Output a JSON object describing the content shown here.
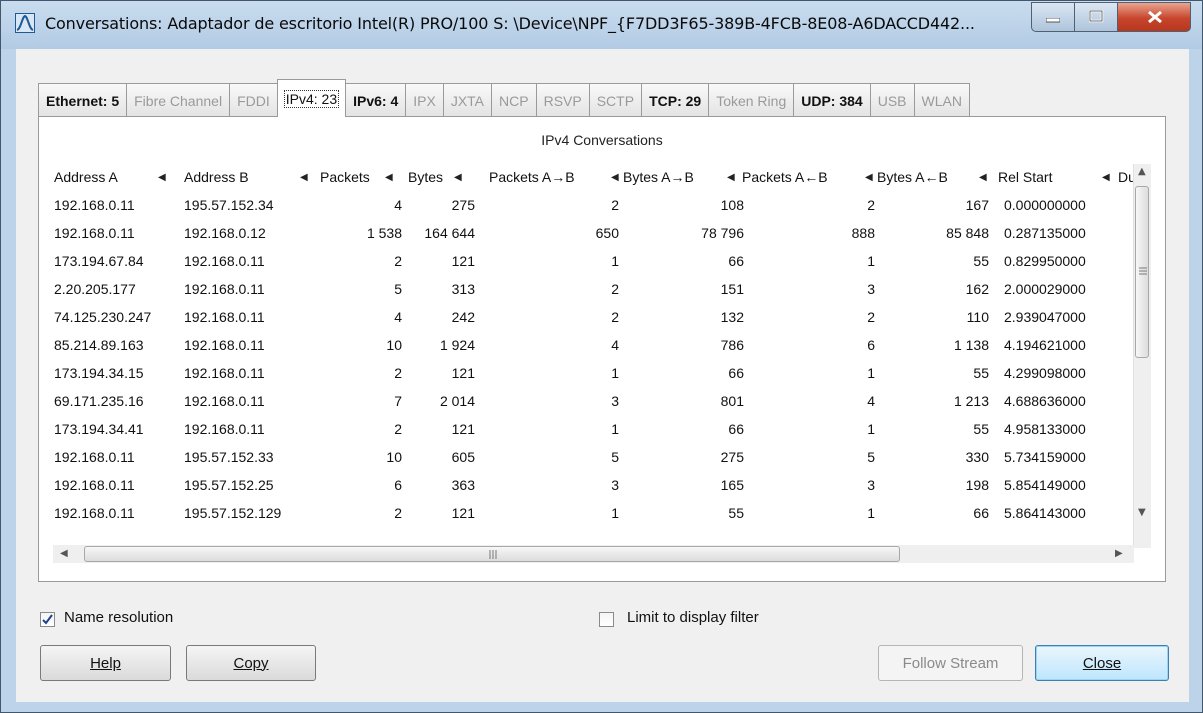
{
  "window": {
    "title": "Conversations: Adaptador de escritorio Intel(R) PRO/100 S: \\Device\\NPF_{F7DD3F65-389B-4FCB-8E08-A6DACCD442..."
  },
  "tabs": [
    {
      "label": "Ethernet: 5",
      "enabled": true
    },
    {
      "label": "Fibre Channel",
      "enabled": false
    },
    {
      "label": "FDDI",
      "enabled": false
    },
    {
      "label": "IPv4: 23",
      "enabled": true,
      "active": true
    },
    {
      "label": "IPv6: 4",
      "enabled": true
    },
    {
      "label": "IPX",
      "enabled": false
    },
    {
      "label": "JXTA",
      "enabled": false
    },
    {
      "label": "NCP",
      "enabled": false
    },
    {
      "label": "RSVP",
      "enabled": false
    },
    {
      "label": "SCTP",
      "enabled": false
    },
    {
      "label": "TCP: 29",
      "enabled": true
    },
    {
      "label": "Token Ring",
      "enabled": false
    },
    {
      "label": "UDP: 384",
      "enabled": true
    },
    {
      "label": "USB",
      "enabled": false
    },
    {
      "label": "WLAN",
      "enabled": false
    }
  ],
  "table": {
    "title": "IPv4 Conversations",
    "columns": [
      "Address A",
      "Address B",
      "Packets",
      "Bytes",
      "Packets A→B",
      "Bytes A→B",
      "Packets A←B",
      "Bytes A←B",
      "Rel Start",
      "Dur"
    ],
    "rows": [
      [
        "192.168.0.11",
        "195.57.152.34",
        "4",
        "275",
        "2",
        "108",
        "2",
        "167",
        "0.000000000"
      ],
      [
        "192.168.0.11",
        "192.168.0.12",
        "1 538",
        "164 644",
        "650",
        "78 796",
        "888",
        "85 848",
        "0.287135000"
      ],
      [
        "173.194.67.84",
        "192.168.0.11",
        "2",
        "121",
        "1",
        "66",
        "1",
        "55",
        "0.829950000"
      ],
      [
        "2.20.205.177",
        "192.168.0.11",
        "5",
        "313",
        "2",
        "151",
        "3",
        "162",
        "2.000029000"
      ],
      [
        "74.125.230.247",
        "192.168.0.11",
        "4",
        "242",
        "2",
        "132",
        "2",
        "110",
        "2.939047000"
      ],
      [
        "85.214.89.163",
        "192.168.0.11",
        "10",
        "1 924",
        "4",
        "786",
        "6",
        "1 138",
        "4.194621000"
      ],
      [
        "173.194.34.15",
        "192.168.0.11",
        "2",
        "121",
        "1",
        "66",
        "1",
        "55",
        "4.299098000"
      ],
      [
        "69.171.235.16",
        "192.168.0.11",
        "7",
        "2 014",
        "3",
        "801",
        "4",
        "1 213",
        "4.688636000"
      ],
      [
        "173.194.34.41",
        "192.168.0.11",
        "2",
        "121",
        "1",
        "66",
        "1",
        "55",
        "4.958133000"
      ],
      [
        "192.168.0.11",
        "195.57.152.33",
        "10",
        "605",
        "5",
        "275",
        "5",
        "330",
        "5.734159000"
      ],
      [
        "192.168.0.11",
        "195.57.152.25",
        "6",
        "363",
        "3",
        "165",
        "3",
        "198",
        "5.854149000"
      ],
      [
        "192.168.0.11",
        "195.57.152.129",
        "2",
        "121",
        "1",
        "55",
        "1",
        "66",
        "5.864143000"
      ]
    ]
  },
  "options": {
    "name_resolution": {
      "label": "Name resolution",
      "checked": true
    },
    "limit_filter": {
      "label": "Limit to display filter",
      "checked": false
    }
  },
  "buttons": {
    "help": "Help",
    "copy": "Copy",
    "follow_stream": "Follow Stream",
    "close": "Close"
  },
  "icons": {
    "sort": "sort-arrow-icon",
    "app": "wireshark-fin-icon"
  }
}
